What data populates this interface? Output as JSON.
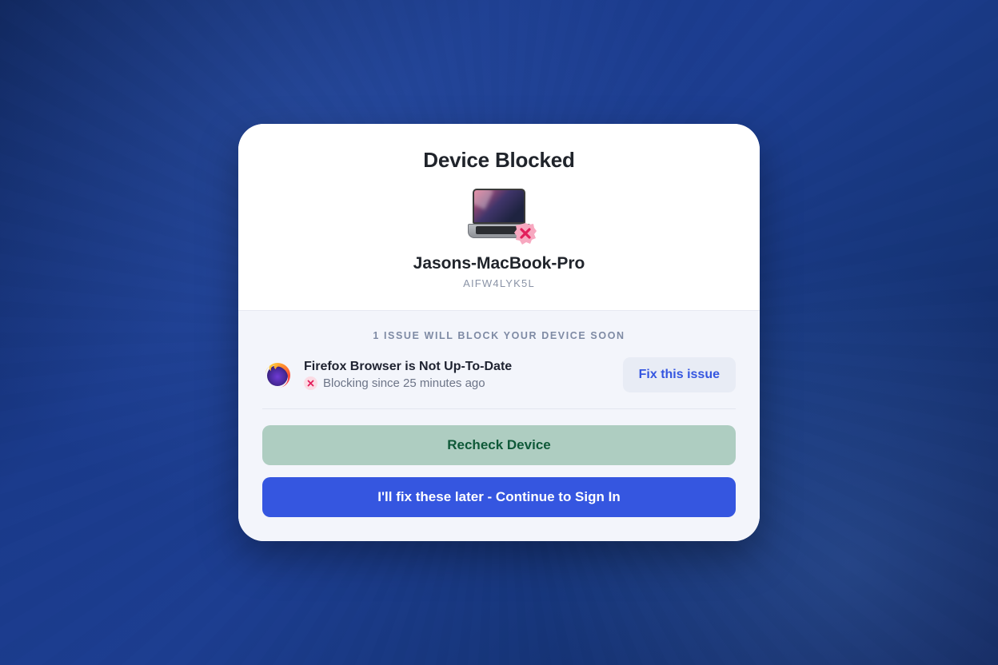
{
  "modal": {
    "title": "Device Blocked",
    "device_name": "Jasons-MacBook-Pro",
    "device_id": "AIFW4LYK5L"
  },
  "body": {
    "banner": "1 ISSUE WILL BLOCK YOUR DEVICE SOON",
    "issue": {
      "title": "Firefox Browser is Not Up-To-Date",
      "status": "Blocking since 25 minutes ago",
      "fix_label": "Fix this issue"
    },
    "recheck_label": "Recheck Device",
    "continue_label": "I'll fix these later - Continue to Sign In"
  },
  "colors": {
    "primary": "#3556e0",
    "danger": "#e21e5b",
    "recheck_bg": "#aecdc1",
    "recheck_text": "#0f5938"
  }
}
